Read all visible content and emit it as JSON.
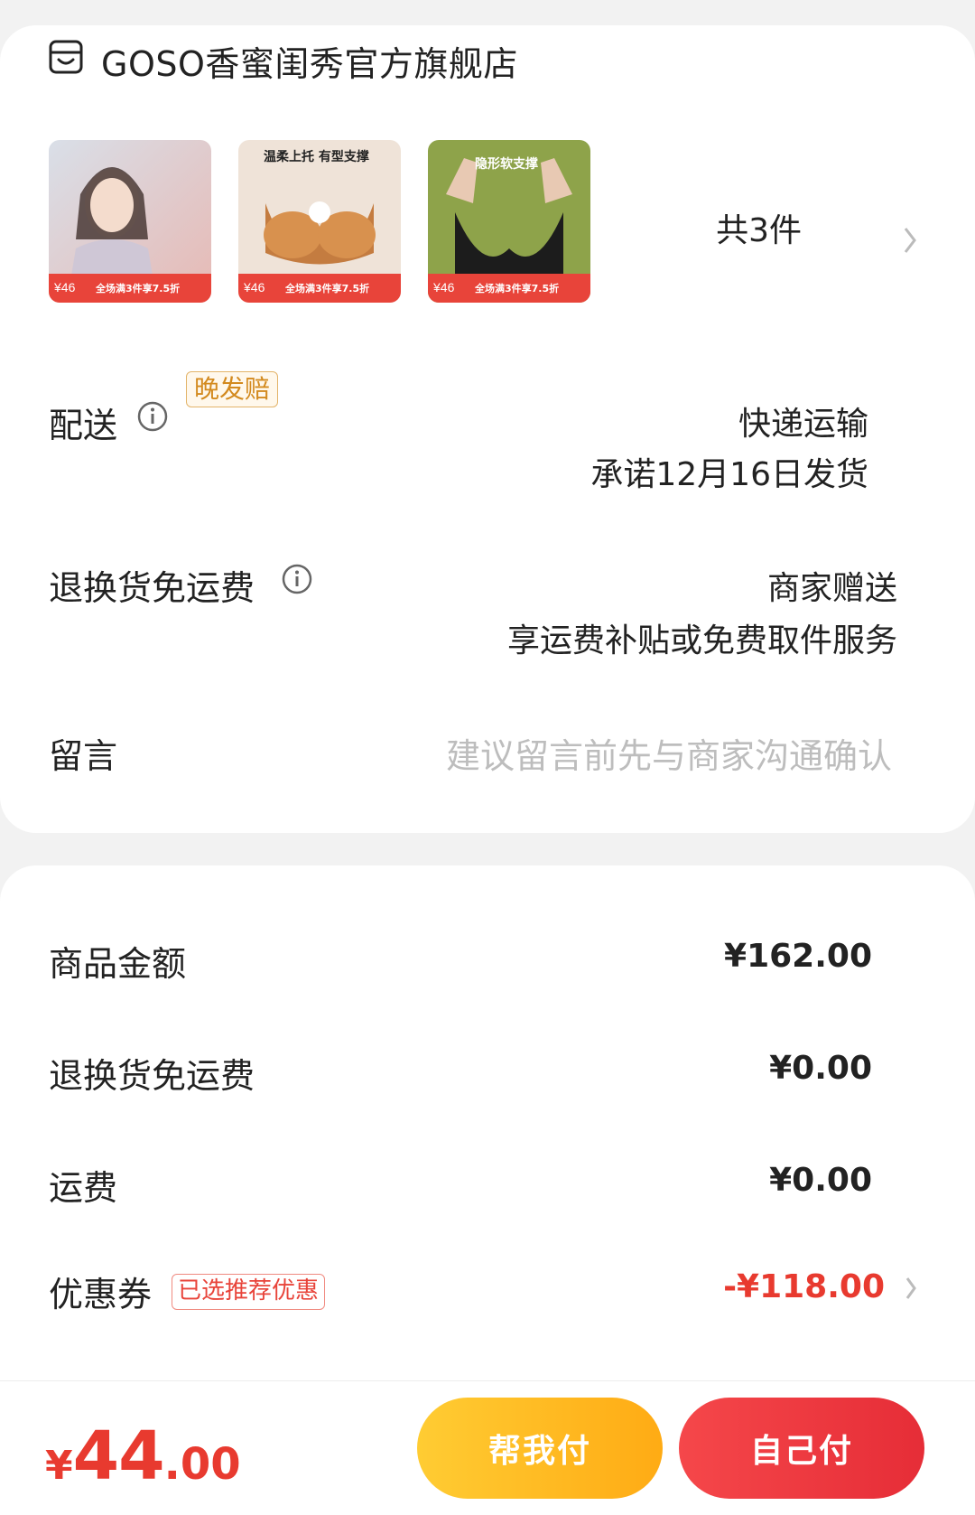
{
  "store": {
    "name": "GOSO香蜜闺秀官方旗舰店",
    "icon": "store-icon"
  },
  "products": {
    "count_label": "共3件",
    "items": [
      {
        "tag_top": "",
        "price": "¥46",
        "promo": "全场满3件享7.5折"
      },
      {
        "tag_top": "温柔上托 有型支撑",
        "price": "¥46",
        "promo": "全场满3件享7.5折"
      },
      {
        "tag_top": "隐形软支撑",
        "price": "¥46",
        "promo": "全场满3件享7.5折"
      }
    ]
  },
  "delivery": {
    "label": "配送",
    "tag": "晚发赔",
    "method": "快递运输",
    "promise": "承诺12月16日发货"
  },
  "return_shipping": {
    "label": "退换货免运费",
    "value": "商家赠送",
    "desc": "享运费补贴或免费取件服务"
  },
  "message": {
    "label": "留言",
    "placeholder": "建议留言前先与商家沟通确认"
  },
  "summary": {
    "goods_label": "商品金额",
    "goods_value": "¥162.00",
    "return_label": "退换货免运费",
    "return_value": "¥0.00",
    "freight_label": "运费",
    "freight_value": "¥0.00",
    "coupon_label": "优惠券",
    "coupon_tag": "已选推荐优惠",
    "coupon_value": "-¥118.00"
  },
  "bottom": {
    "currency": "¥",
    "total_int": "44",
    "total_dec": ".00",
    "help_pay": "帮我付",
    "self_pay": "自己付"
  },
  "colors": {
    "accent_red": "#e83a2f",
    "help_btn": "#ffb81f",
    "self_btn": "#ec3a40",
    "tag_orange": "#d38a1f"
  }
}
